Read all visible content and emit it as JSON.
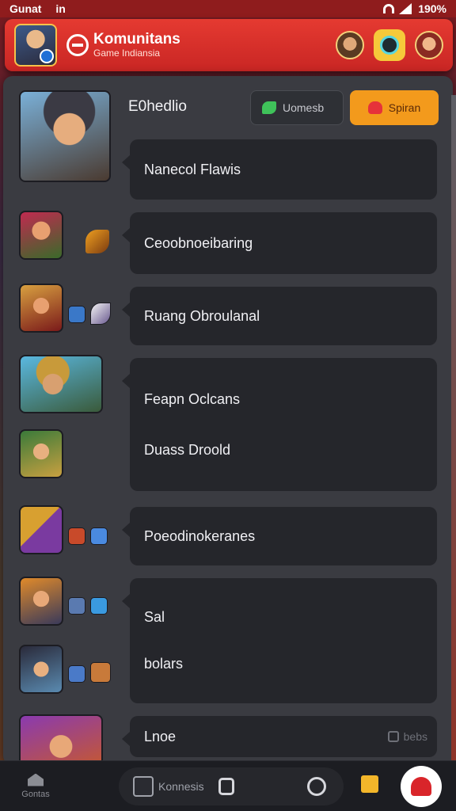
{
  "status_bar": {
    "left_text": "Gunat",
    "left_extra": "in",
    "battery": "190%"
  },
  "header": {
    "title": "Komunitans",
    "subtitle": "Game Indiansia"
  },
  "section": {
    "label": "E0hedlio",
    "chip_dark": "Uomesb",
    "chip_orange": "Spiran"
  },
  "messages": [
    {
      "text": "Nanecol Flawis"
    },
    {
      "text": "Ceoobnoeibaring"
    },
    {
      "text": "Ruang Obroulanal"
    },
    {
      "text": "Feapn Oclcans",
      "text2": "Duass Droold"
    },
    {
      "text": "Poeodinokeranes"
    },
    {
      "text": "Sal",
      "text2": "bolars"
    },
    {
      "text": "Lnoe",
      "meta": "bebs"
    }
  ],
  "bottom_nav": {
    "home_label": "Gontas",
    "pill_text": "Konnesis"
  },
  "colors": {
    "accent_red": "#e53a31",
    "accent_orange": "#f39a1c",
    "panel": "#3a3b41",
    "bubble": "#25262b"
  }
}
